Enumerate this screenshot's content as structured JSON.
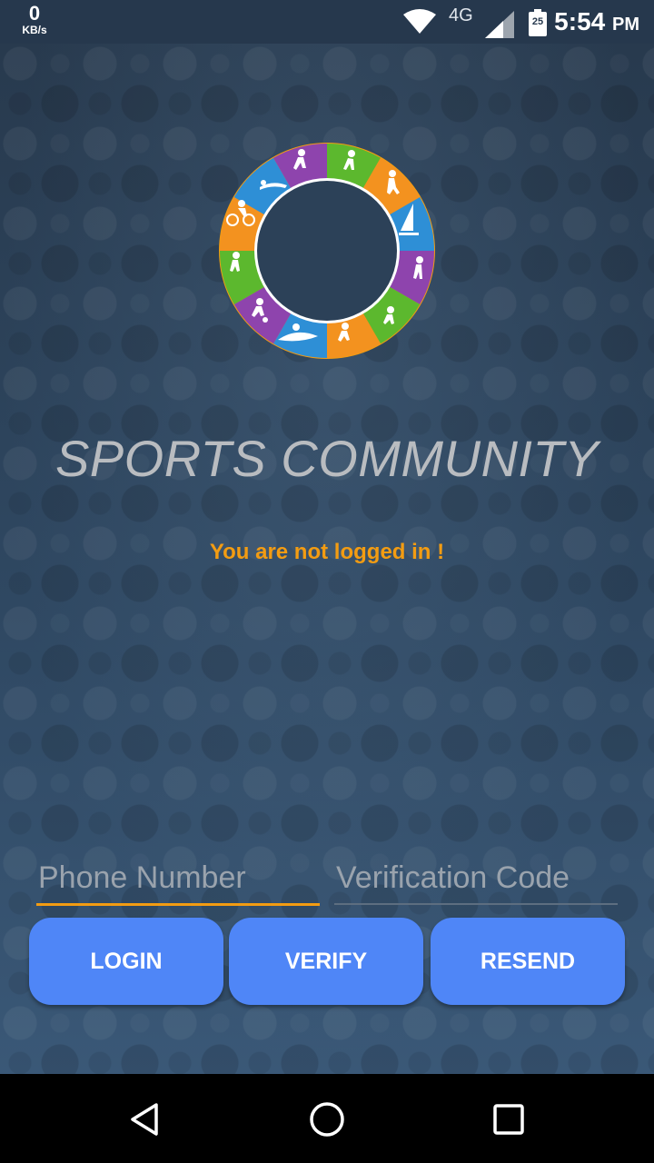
{
  "status_bar": {
    "net_speed_value": "0",
    "net_speed_unit": "KB/s",
    "network_type": "4G",
    "battery_level": "25",
    "time": "5:54",
    "ampm": "PM",
    "icons": [
      "wifi-icon",
      "signal-icon",
      "battery-icon"
    ]
  },
  "app": {
    "title": "SPORTS COMMUNITY",
    "status_message": "You are not logged in !",
    "logo": "sports-ring-logo"
  },
  "form": {
    "phone_placeholder": "Phone Number",
    "phone_value": "",
    "code_placeholder": "Verification Code",
    "code_value": ""
  },
  "buttons": {
    "login": "LOGIN",
    "verify": "VERIFY",
    "resend": "RESEND"
  },
  "nav": {
    "icons": [
      "back-icon",
      "home-icon",
      "recents-icon"
    ]
  },
  "colors": {
    "accent": "#f39c12",
    "button": "#4f86f7",
    "ring_purple": "#8e44ad",
    "ring_green": "#5cb82e",
    "ring_orange": "#f3921f",
    "ring_blue": "#2e8fd6"
  }
}
